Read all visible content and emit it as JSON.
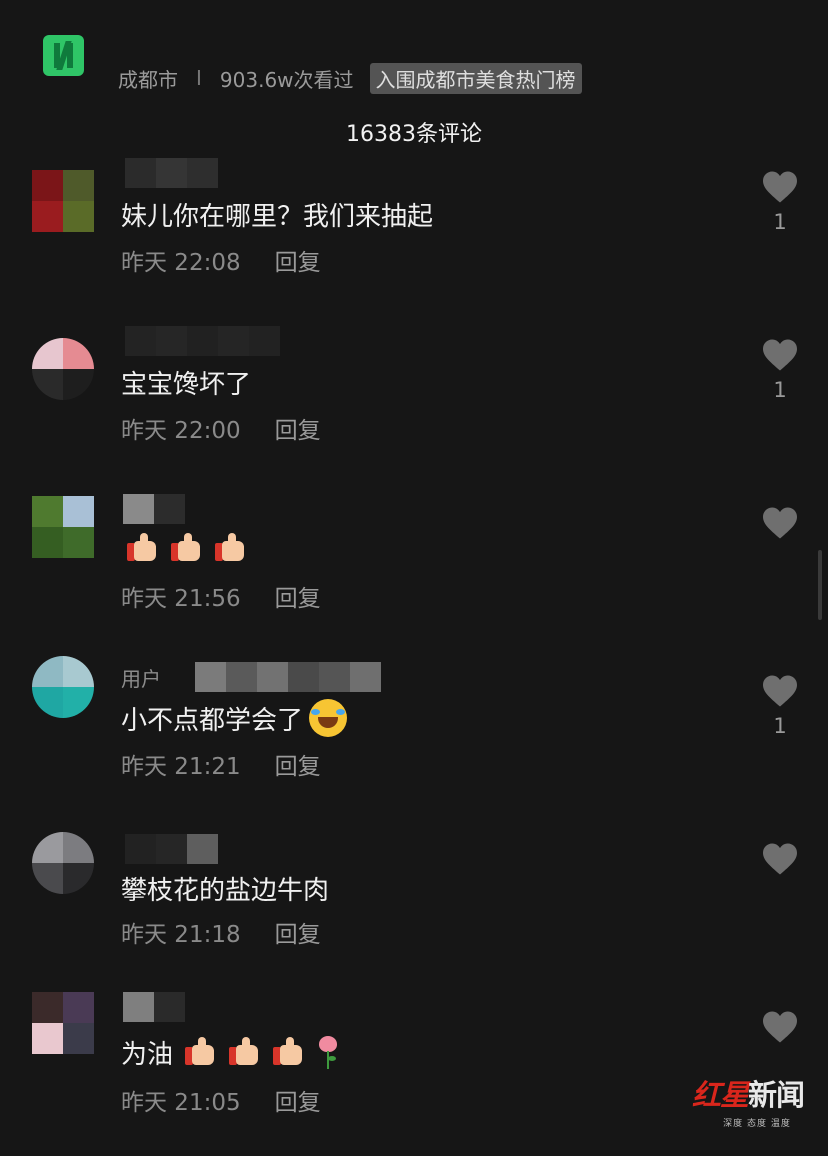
{
  "header": {
    "location": "成都市",
    "separator": "I",
    "views": "903.6w次看过",
    "tag": "入围成都市美食热门榜",
    "comment_count": "16383条评论"
  },
  "comments": [
    {
      "username": "",
      "text": "妹儿你在哪里？我们来抽起",
      "time": "昨天 22:08",
      "reply": "回复",
      "likes": "1",
      "avatar_colors": [
        "#7b1518",
        "#4f5a2a",
        "#9a1c1f",
        "#5a6b28"
      ]
    },
    {
      "username": "",
      "text": "宝宝馋坏了",
      "time": "昨天 22:00",
      "reply": "回复",
      "likes": "1",
      "avatar_colors": [
        "#e7c6cf",
        "#e58b92",
        "#2a2a2a",
        "#1e1e1e"
      ]
    },
    {
      "username": "",
      "text": "",
      "time": "昨天 21:56",
      "reply": "回复",
      "likes": "",
      "avatar_colors": [
        "#4f7a2f",
        "#a9c0d6",
        "#355e22",
        "#3f6b2a"
      ]
    },
    {
      "username": "用户",
      "text": "小不点都学会了",
      "time": "昨天 21:21",
      "reply": "回复",
      "likes": "1",
      "avatar_colors": [
        "#8fb9c3",
        "#a8c9d0",
        "#1fa7a3",
        "#22b0a8"
      ]
    },
    {
      "username": "",
      "text": "攀枝花的盐边牛肉",
      "time": "昨天 21:18",
      "reply": "回复",
      "likes": "",
      "avatar_colors": [
        "#9a9a9e",
        "#7c7c80",
        "#4a4a4d",
        "#2a2a2c"
      ]
    },
    {
      "username": "",
      "text": "为油",
      "time": "昨天 21:05",
      "reply": "回复",
      "likes": "",
      "avatar_colors": [
        "#3b2a2a",
        "#4a3a55",
        "#e9c8cf",
        "#3b3b4a"
      ]
    }
  ],
  "watermark": {
    "logo_red": "红星",
    "logo_text": "新闻",
    "slogan": "深度 态度 温度"
  }
}
